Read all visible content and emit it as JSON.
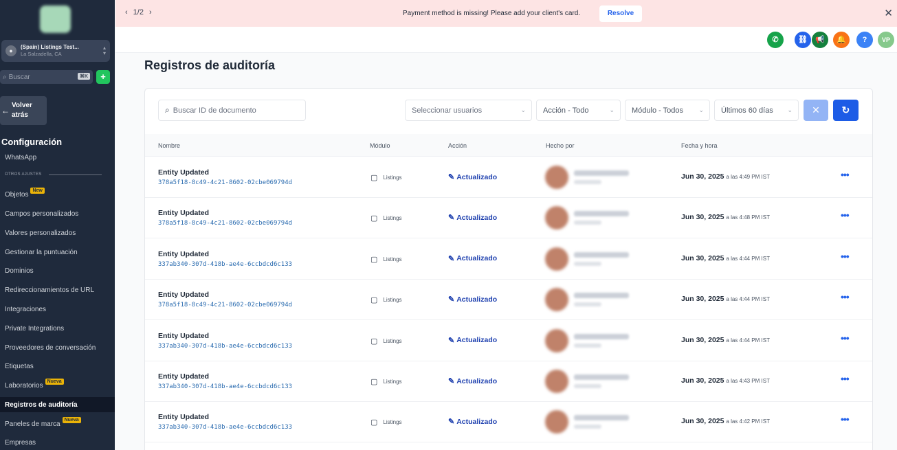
{
  "sidebar": {
    "account": {
      "name": "(Spain) Listings Test...",
      "location": "La Salzadella, CA"
    },
    "search": {
      "placeholder": "Buscar",
      "shortcut": "⌘K"
    },
    "back": {
      "line1": "Volver",
      "line2": "atrás"
    },
    "section_title": "Configuración",
    "items": [
      {
        "label": "WhatsApp"
      },
      {
        "label": "OTROS AJUSTES"
      },
      {
        "label": "Objetos",
        "badge": "New"
      },
      {
        "label": "Campos personalizados"
      },
      {
        "label": "Valores personalizados"
      },
      {
        "label": "Gestionar la puntuación"
      },
      {
        "label": "Dominios"
      },
      {
        "label": "Redireccionamientos de URL"
      },
      {
        "label": "Integraciones"
      },
      {
        "label": "Private Integrations"
      },
      {
        "label": "Proveedores de conversación"
      },
      {
        "label": "Etiquetas"
      },
      {
        "label": "Laboratorios",
        "badge": "Nueva"
      },
      {
        "label": "Registros de auditoría",
        "active": true
      },
      {
        "label": "Paneles de marca",
        "badge": "Nueva"
      },
      {
        "label": "Empresas"
      }
    ]
  },
  "banner": {
    "pager": "1/2",
    "message": "Payment method is missing! Please add your client's card.",
    "resolve": "Resolve"
  },
  "header": {
    "icons": [
      {
        "name": "phone-icon",
        "color": "#16a34a",
        "glyph": "✆"
      },
      {
        "name": "link-icon",
        "color": "#2563eb",
        "glyph": "⛓"
      },
      {
        "name": "megaphone-icon",
        "color": "#15803d",
        "glyph": "📢"
      },
      {
        "name": "bell-icon",
        "color": "#f97316",
        "glyph": "🔔"
      },
      {
        "name": "help-icon",
        "color": "#3b82f6",
        "glyph": "?"
      },
      {
        "name": "user-avatar",
        "color": "#86c98c",
        "glyph": "VP"
      }
    ]
  },
  "page": {
    "title": "Registros de auditoría"
  },
  "filters": {
    "search_placeholder": "Buscar ID de documento",
    "users": "Seleccionar usuarios",
    "action": "Acción - Todo",
    "module": "Módulo - Todos",
    "range": "Últimos 60 días"
  },
  "table": {
    "headers": {
      "name": "Nombre",
      "module": "Módulo",
      "action": "Acción",
      "by": "Hecho por",
      "date": "Fecha y hora"
    },
    "rows": [
      {
        "title": "Entity Updated",
        "id": "378a5f18-8c49-4c21-8602-02cbe069794d",
        "module": "Listings",
        "action": "Actualizado",
        "date": "Jun 30, 2025",
        "time": "a las 4:49 PM IST"
      },
      {
        "title": "Entity Updated",
        "id": "378a5f18-8c49-4c21-8602-02cbe069794d",
        "module": "Listings",
        "action": "Actualizado",
        "date": "Jun 30, 2025",
        "time": "a las 4:48 PM IST"
      },
      {
        "title": "Entity Updated",
        "id": "337ab340-307d-418b-ae4e-6ccbdcd6c133",
        "module": "Listings",
        "action": "Actualizado",
        "date": "Jun 30, 2025",
        "time": "a las 4:44 PM IST"
      },
      {
        "title": "Entity Updated",
        "id": "378a5f18-8c49-4c21-8602-02cbe069794d",
        "module": "Listings",
        "action": "Actualizado",
        "date": "Jun 30, 2025",
        "time": "a las 4:44 PM IST"
      },
      {
        "title": "Entity Updated",
        "id": "337ab340-307d-418b-ae4e-6ccbdcd6c133",
        "module": "Listings",
        "action": "Actualizado",
        "date": "Jun 30, 2025",
        "time": "a las 4:44 PM IST"
      },
      {
        "title": "Entity Updated",
        "id": "337ab340-307d-418b-ae4e-6ccbdcd6c133",
        "module": "Listings",
        "action": "Actualizado",
        "date": "Jun 30, 2025",
        "time": "a las 4:43 PM IST"
      },
      {
        "title": "Entity Updated",
        "id": "337ab340-307d-418b-ae4e-6ccbdcd6c133",
        "module": "Listings",
        "action": "Actualizado",
        "date": "Jun 30, 2025",
        "time": "a las 4:42 PM IST"
      }
    ]
  }
}
